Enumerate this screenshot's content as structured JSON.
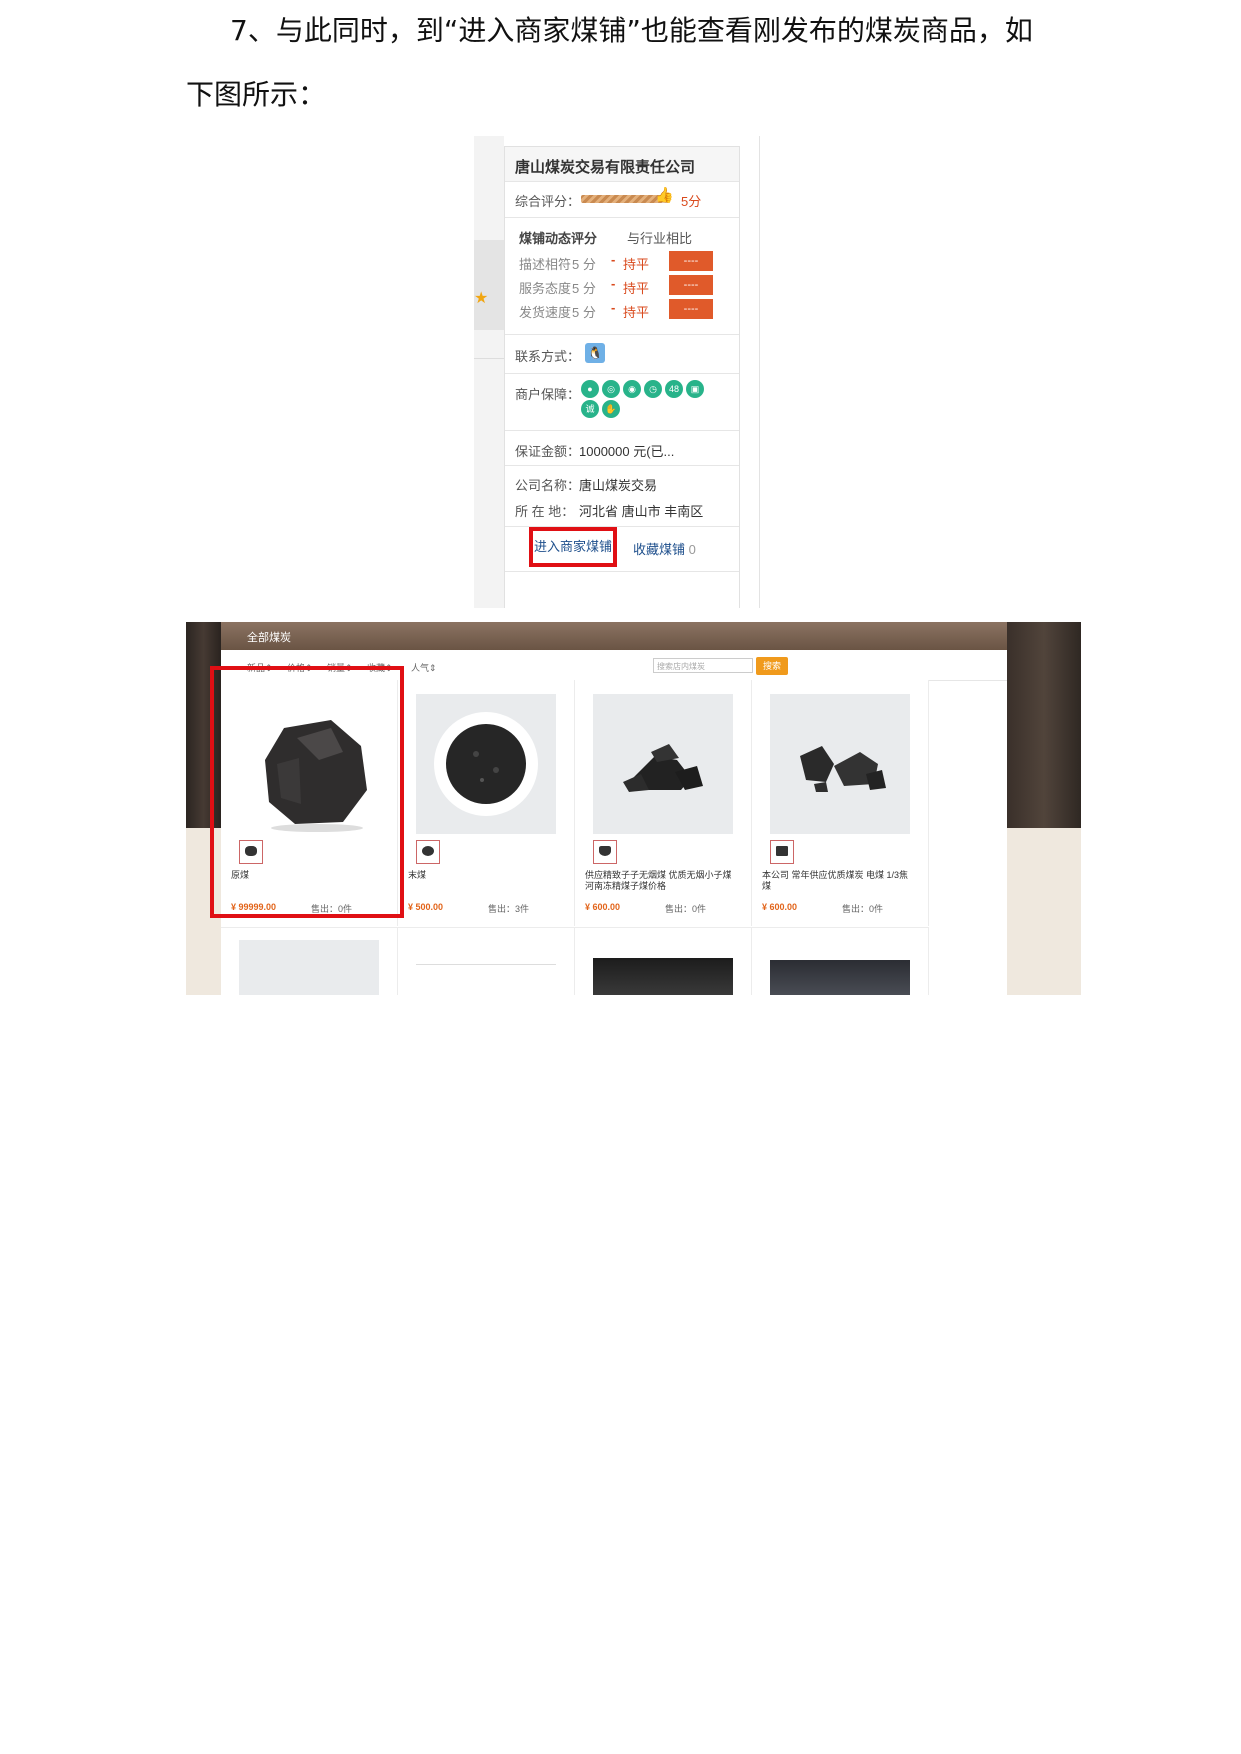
{
  "paragraph": {
    "line1": "7、与此同时，到“进入商家煤铺”也能查看刚发布的煤炭商品，如",
    "line2": "下图所示："
  },
  "shop_panel": {
    "company_name": "唐山煤炭交易有限责任公司",
    "overall_score_label": "综合评分：",
    "overall_score_value": "5分",
    "dynamic_header": "煤铺动态评分",
    "compare_header": "与行业相比",
    "ratings": [
      {
        "label": "描述相符",
        "score": "5 分",
        "minus": "-",
        "level": "持平",
        "box": "----"
      },
      {
        "label": "服务态度",
        "score": "5 分",
        "minus": "-",
        "level": "持平",
        "box": "----"
      },
      {
        "label": "发货速度",
        "score": "5 分",
        "minus": "-",
        "level": "持平",
        "box": "----"
      }
    ],
    "contact_label": "联系方式：",
    "guarantee_label": "商户保障：",
    "guarantee_icons": [
      "location-icon",
      "camera-icon",
      "eye-icon",
      "clock-icon",
      "48h-icon",
      "delivery-icon",
      "integrity-icon",
      "handshake-icon"
    ],
    "deposit_label": "保证金额：",
    "deposit_value": "1000000 元(已...",
    "company_label": "公司名称：",
    "company_value": "唐山煤炭交易",
    "location_label": "所 在 地：",
    "location_value": "河北省 唐山市 丰南区",
    "enter_button": "进入商家煤铺",
    "favorite_label": "收藏煤铺",
    "favorite_count": "0",
    "colors": {
      "accent_red": "#e00f14",
      "rate_box": "#e05a2a",
      "link_blue": "#1e4f8c"
    }
  },
  "store": {
    "header_title": "全部煤炭",
    "sort_items": [
      "新品",
      "价格",
      "销量",
      "收藏",
      "人气"
    ],
    "search_placeholder": "搜索店内煤炭",
    "search_button": "搜索",
    "products": [
      {
        "name": "原煤",
        "price": "¥ 99999.00",
        "sold": "售出：0件"
      },
      {
        "name": "末煤",
        "price": "¥ 500.00",
        "sold": "售出：3件"
      },
      {
        "name": "供应精致子子无烟煤 优质无烟小子煤 河南冻精煤子煤价格",
        "price": "¥ 600.00",
        "sold": "售出：0件"
      },
      {
        "name": "本公司 常年供应优质煤炭 电煤 1/3焦煤",
        "price": "¥ 600.00",
        "sold": "售出：0件"
      }
    ]
  }
}
